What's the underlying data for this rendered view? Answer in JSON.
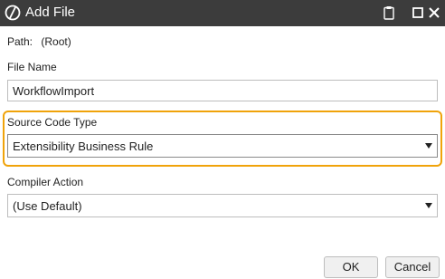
{
  "window": {
    "title": "Add File",
    "icons": {
      "app": "onestream-logo-icon",
      "clipboard": "clipboard-icon",
      "maximize": "maximize-icon",
      "close": "close-icon"
    }
  },
  "form": {
    "path_label": "Path:",
    "path_value": "(Root)",
    "file_name_label": "File Name",
    "file_name_value": "WorkflowImport",
    "source_code_type_label": "Source Code Type",
    "source_code_type_value": "Extensibility Business Rule",
    "compiler_action_label": "Compiler Action",
    "compiler_action_value": "(Use Default)"
  },
  "buttons": {
    "ok_label": "OK",
    "cancel_label": "Cancel"
  },
  "colors": {
    "titlebar": "#3c3c3c",
    "highlight": "#f0a30a"
  }
}
